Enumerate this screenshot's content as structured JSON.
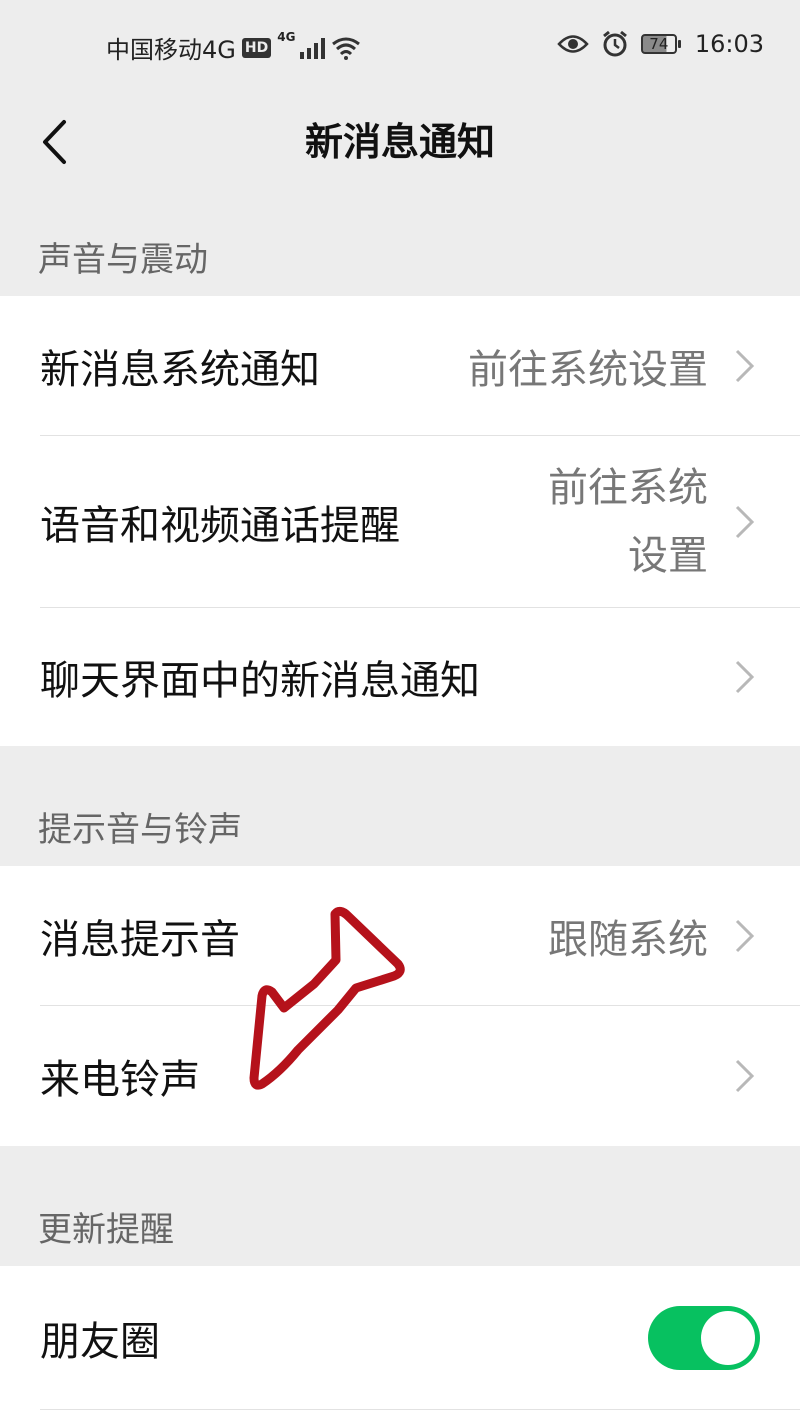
{
  "status_bar": {
    "carrier": "中国移动4G",
    "hd_badge": "HD",
    "network_type": "4G",
    "battery_level": "74",
    "time": "16:03"
  },
  "nav": {
    "title": "新消息通知"
  },
  "sections": {
    "sound_vibration": {
      "header": "声音与震动",
      "items": [
        {
          "label": "新消息系统通知",
          "value": "前往系统设置"
        },
        {
          "label": "语音和视频通话提醒",
          "value": "前往系统设置"
        },
        {
          "label": "聊天界面中的新消息通知",
          "value": ""
        }
      ]
    },
    "tones_ringtones": {
      "header": "提示音与铃声",
      "items": [
        {
          "label": "消息提示音",
          "value": "跟随系统"
        },
        {
          "label": "来电铃声",
          "value": ""
        }
      ]
    },
    "update_reminders": {
      "header": "更新提醒",
      "items": [
        {
          "label": "朋友圈",
          "toggle_on": true
        }
      ]
    }
  },
  "colors": {
    "background": "#ededed",
    "toggle_active": "#07c160",
    "annotation_arrow": "#b5121b"
  }
}
